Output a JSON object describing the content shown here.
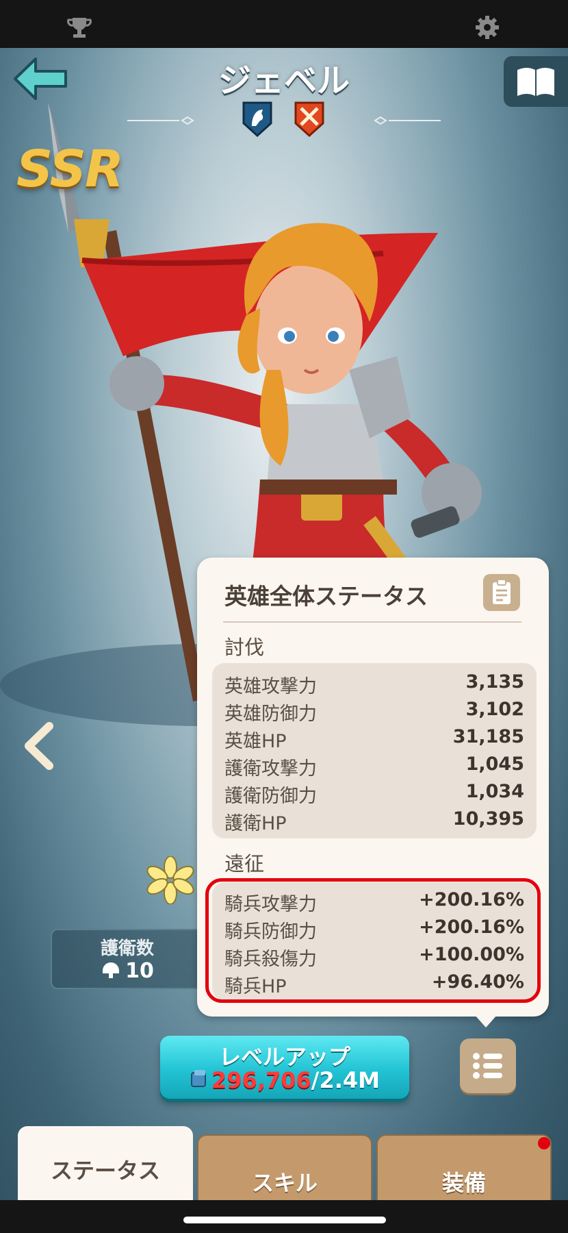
{
  "header": {
    "hero_name": "ジェベル",
    "rarity": "SSR"
  },
  "panel": {
    "title": "英雄全体ステータス",
    "sections": [
      {
        "label": "討伐",
        "rows": [
          {
            "label": "英雄攻撃力",
            "value": "3,135"
          },
          {
            "label": "英雄防御力",
            "value": "3,102"
          },
          {
            "label": "英雄HP",
            "value": "31,185"
          },
          {
            "label": "護衛攻撃力",
            "value": "1,045"
          },
          {
            "label": "護衛防御力",
            "value": "1,034"
          },
          {
            "label": "護衛HP",
            "value": "10,395"
          }
        ]
      },
      {
        "label": "遠征",
        "rows": [
          {
            "label": "騎兵攻撃力",
            "value": "+200.16%"
          },
          {
            "label": "騎兵防御力",
            "value": "+200.16%"
          },
          {
            "label": "騎兵殺傷力",
            "value": "+100.00%"
          },
          {
            "label": "騎兵HP",
            "value": "+96.40%"
          }
        ]
      }
    ]
  },
  "escort": {
    "label": "護衛数",
    "value": "10"
  },
  "level_up": {
    "label": "レベルアップ",
    "current": "296,706",
    "required": "/2.4M"
  },
  "tabs": [
    {
      "label": "ステータス",
      "active": true
    },
    {
      "label": "スキル",
      "active": false
    },
    {
      "label": "装備",
      "active": false
    }
  ],
  "colors": {
    "highlight": "#e3000f",
    "accent_teal": "#22c3d4",
    "panel_bg": "#fbf6ef",
    "tab_brown": "#c49a6c"
  },
  "icons": [
    "trophy-icon",
    "gear-icon",
    "back-arrow-icon",
    "book-icon",
    "cavalry-badge-icon",
    "crossed-swords-badge-icon",
    "chevron-left-icon",
    "star-flower-icon",
    "helmet-icon",
    "clipboard-icon",
    "list-icon",
    "resource-icon"
  ]
}
